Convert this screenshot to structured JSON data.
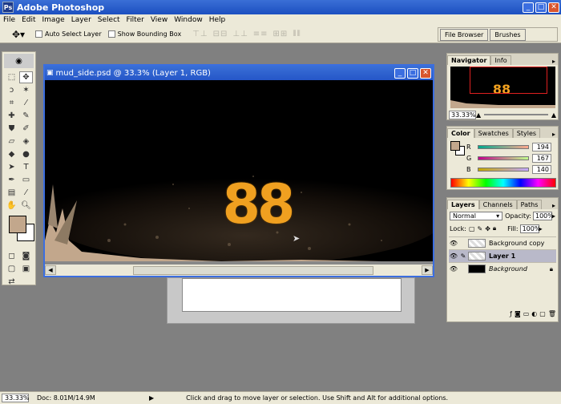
{
  "app": {
    "title": "Adobe Photoshop"
  },
  "menu": [
    "File",
    "Edit",
    "Image",
    "Layer",
    "Select",
    "Filter",
    "View",
    "Window",
    "Help"
  ],
  "options": {
    "auto_select_layer": "Auto Select Layer",
    "show_bounding_box": "Show Bounding Box"
  },
  "palette_well": {
    "tabs": [
      "File Browser",
      "Brushes"
    ]
  },
  "document": {
    "title": "mud_side.psd @ 33.3% (Layer 1, RGB)",
    "text": "88"
  },
  "navigator": {
    "tabs": [
      "Navigator",
      "Info"
    ],
    "zoom": "33.33%"
  },
  "color": {
    "tabs": [
      "Color",
      "Swatches",
      "Styles"
    ],
    "foreground": "#c2a78c",
    "channels": [
      {
        "label": "R",
        "value": "194"
      },
      {
        "label": "G",
        "value": "167"
      },
      {
        "label": "B",
        "value": "140"
      }
    ]
  },
  "layers_panel": {
    "tabs": [
      "Layers",
      "Channels",
      "Paths"
    ],
    "blend_mode": "Normal",
    "opacity_label": "Opacity:",
    "opacity": "100%",
    "lock_label": "Lock:",
    "fill_label": "Fill:",
    "fill": "100%",
    "layers": [
      {
        "name": "Background copy"
      },
      {
        "name": "Layer 1"
      },
      {
        "name": "Background"
      }
    ]
  },
  "status": {
    "zoom": "33.33%",
    "doc": "Doc: 8.01M/14.9M",
    "message": "Click and drag to move layer or selection.  Use Shift and Alt for additional options."
  },
  "colors": {
    "accent": "#f0a020",
    "mud": "#c2a78c"
  }
}
